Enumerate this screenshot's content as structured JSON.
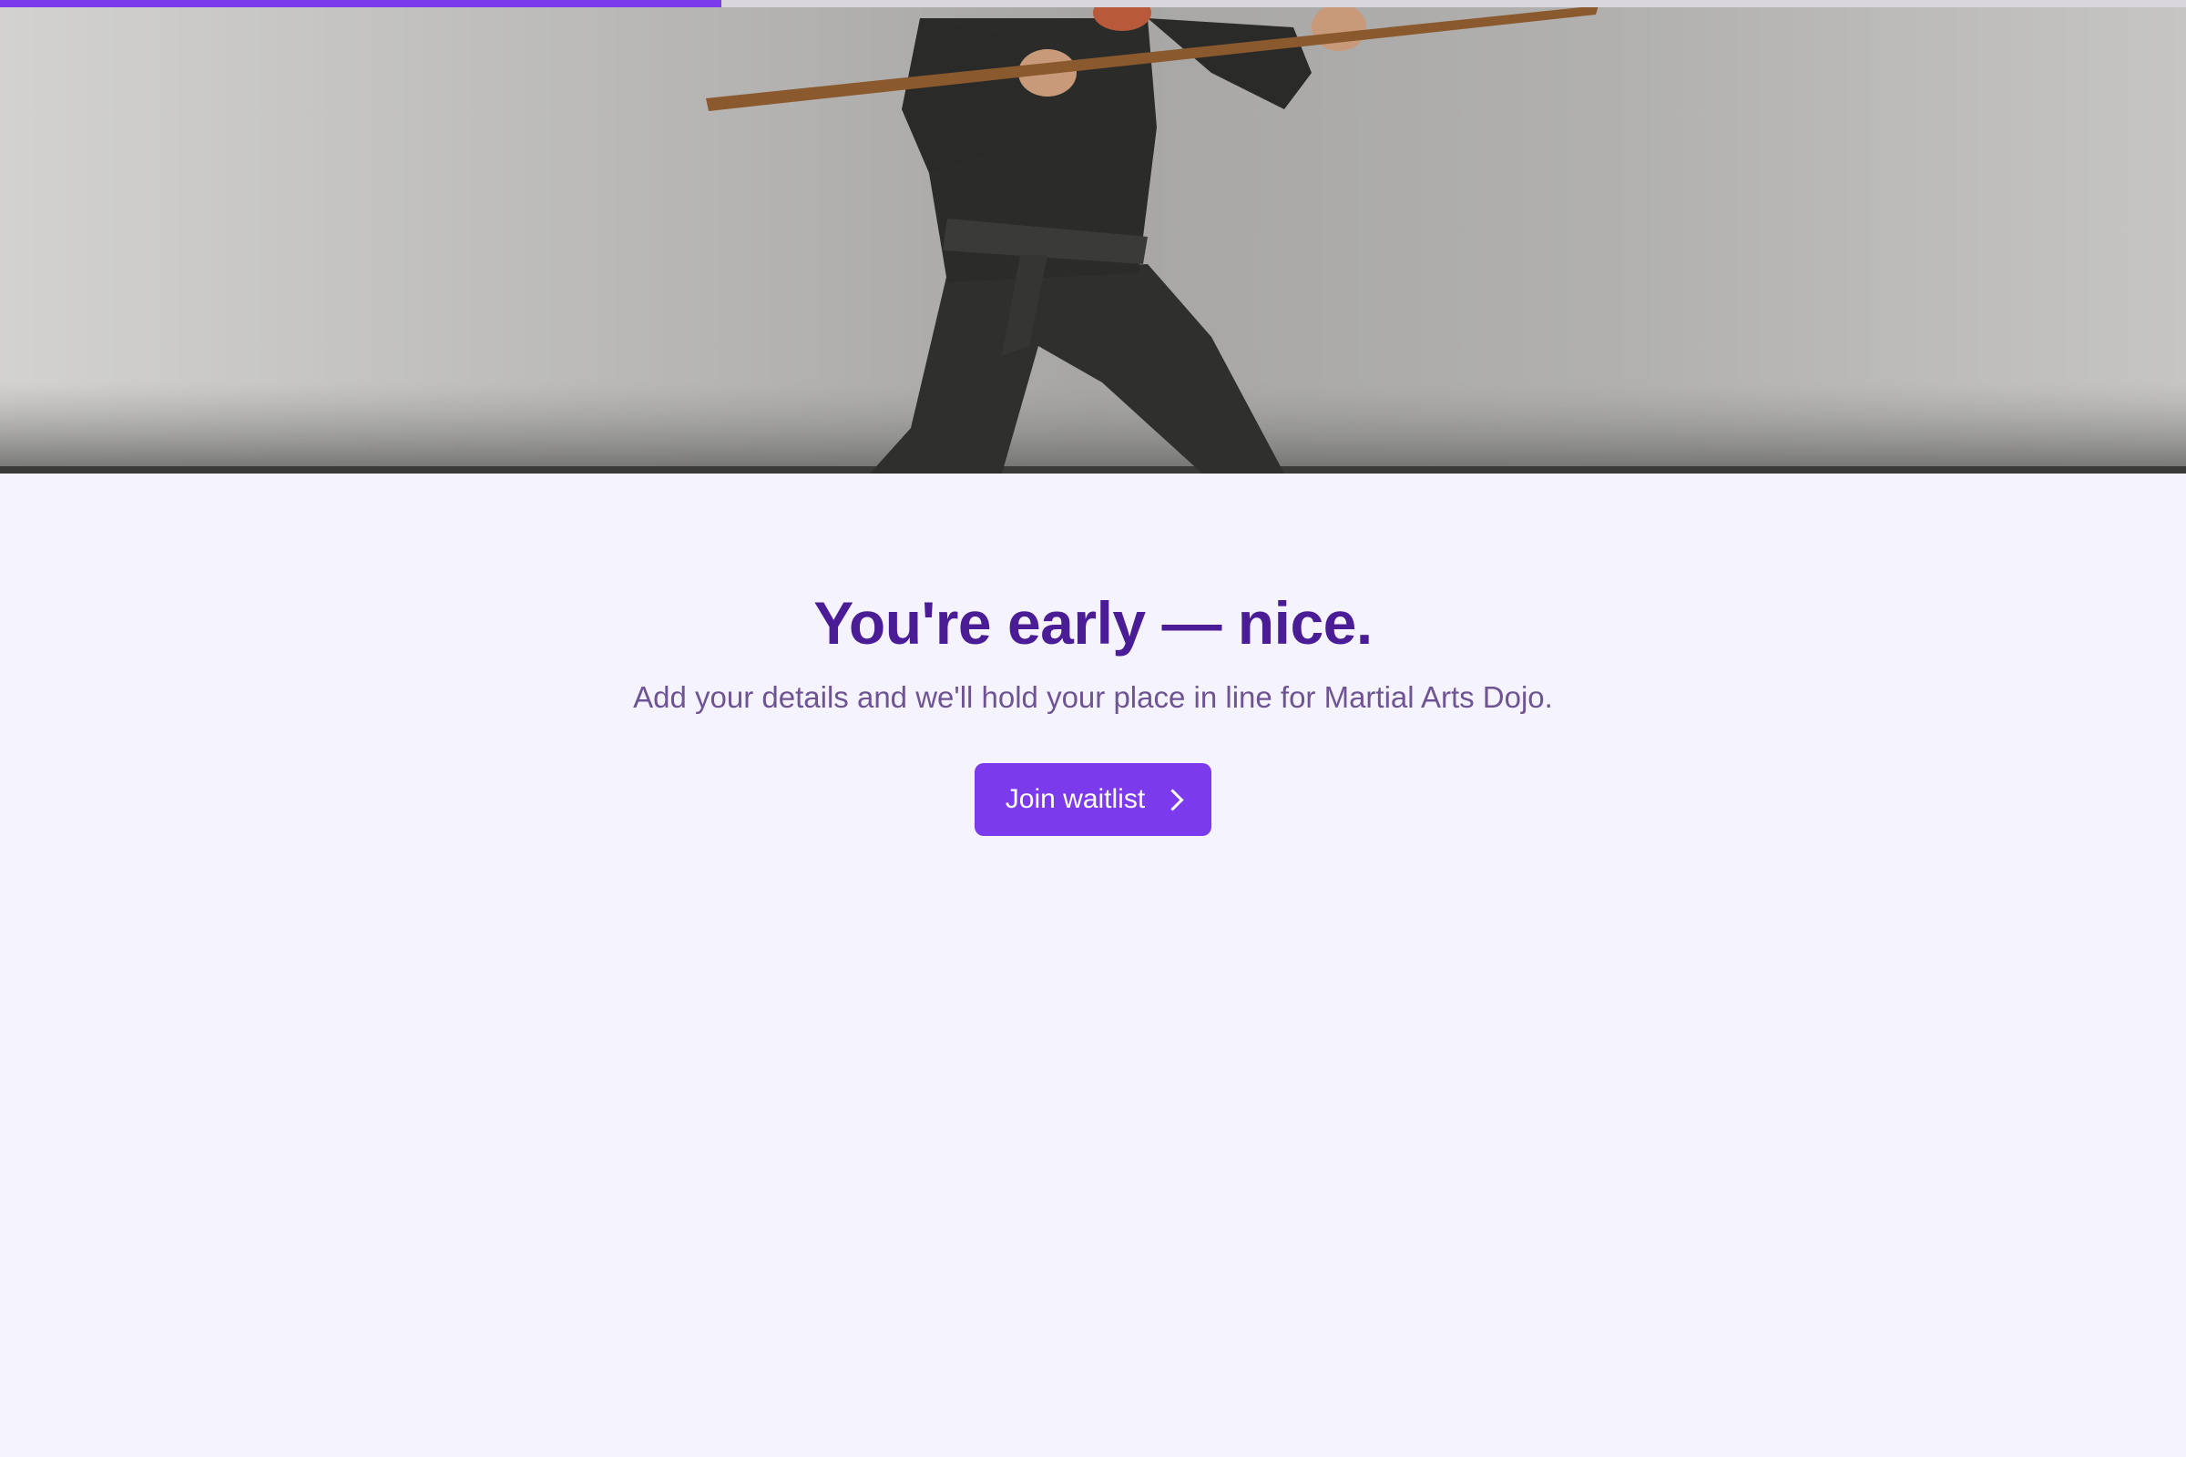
{
  "progress": {
    "fraction": 0.33
  },
  "hero": {
    "image": "martial-artist-with-bo-staff"
  },
  "main": {
    "headline": "You're early — nice.",
    "subtext": "Add your details and we'll hold your place in line for Martial Arts Dojo.",
    "cta_label": "Join waitlist",
    "cta_icon": "chevron-right-icon"
  },
  "colors": {
    "accent": "#7C3AED",
    "headline": "#4A1D96",
    "subtext": "#6E5494",
    "background": "#F5F3FE"
  }
}
